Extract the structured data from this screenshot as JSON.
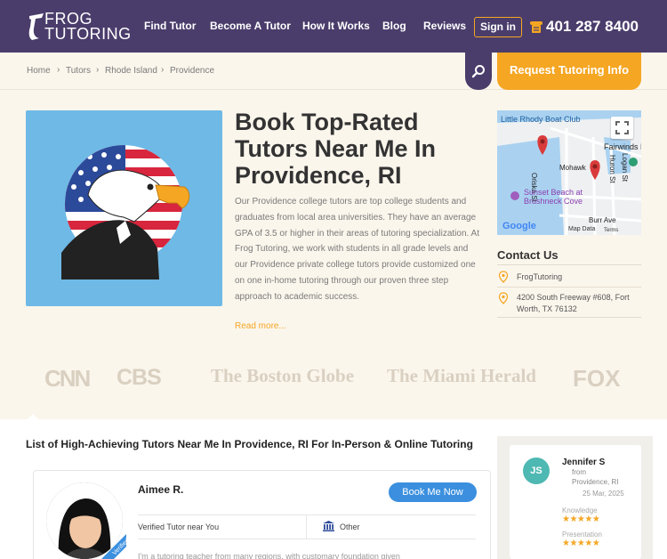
{
  "header": {
    "logo_line1": "FROG",
    "logo_line2": "TUTORING",
    "nav": [
      "Find Tutor",
      "Become A Tutor",
      "How It Works",
      "Blog",
      "Reviews"
    ],
    "signin_label": "Sign in",
    "phone": "401 287 8400"
  },
  "breadcrumb": [
    "Home",
    "Tutors",
    "Rhode Island",
    "Providence"
  ],
  "request_label": "Request Tutoring Info",
  "hero": {
    "title": "Book Top-Rated Tutors Near Me In Providence, RI",
    "text": "Our Providence college tutors are top college students and graduates from local area universities. They have an average GPA of 3.5 or higher in their areas of tutoring specialization. At Frog Tutoring, we work with students in all grade levels and our Providence private college tutors provide customized one on one in-home tutoring through our proven three step approach to academic success.",
    "read_more": "Read more..."
  },
  "map": {
    "labels": [
      "Little Rhody Boat Club",
      "Fairwinds Mar",
      "Mohawk",
      "Oriska St",
      "Huron St",
      "Logan St",
      "Sunset Beach at",
      "Brushneck Cove",
      "Burr Ave"
    ],
    "footer": [
      "Google",
      "Map Data",
      "Terms"
    ]
  },
  "contact": {
    "title": "Contact Us",
    "name": "FrogTutoring",
    "address": "4200 South Freeway #608, Fort Worth, TX 76132"
  },
  "press": [
    "CNN",
    "CBS",
    "The Boston Globe",
    "The Miami Herald",
    "FOX"
  ],
  "listing": {
    "title": "List of High-Achieving Tutors Near Me In Providence, RI For In-Person & Online Tutoring",
    "tutor": {
      "name": "Aimee R.",
      "book_label": "Book Me Now",
      "verified": "Verified Tutor near You",
      "category": "Other",
      "ribbon": "Verified",
      "snippet": "I'm a tutoring teacher from many regions, with customary foundation given"
    }
  },
  "review": {
    "initials": "JS",
    "name": "Jennifer S",
    "from": "from",
    "location": "Providence, RI",
    "date": "25 Mar, 2025",
    "label_knowledge": "Knowledge",
    "label_presentation": "Presentation",
    "stars": "★★★★★"
  },
  "colors": {
    "header_bg": "#4a3d6b",
    "accent": "#f5a623",
    "button_blue": "#3b8fde",
    "page_bg": "#fbf6ec"
  }
}
